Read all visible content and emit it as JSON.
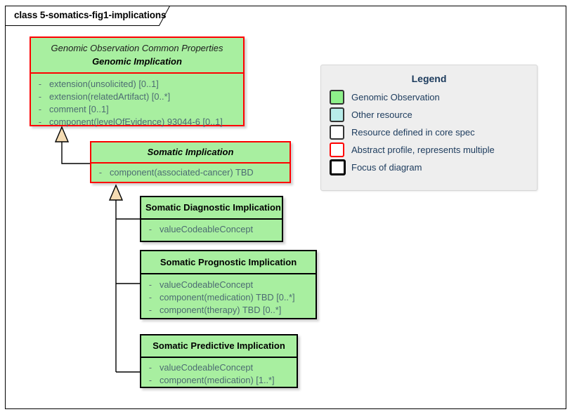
{
  "diagram": {
    "tab_label": "class 5-somatics-fig1-implications",
    "colors": {
      "genomic_observation_fill": "#a8efa0",
      "other_resource_fill": "#b8ece9",
      "core_spec_fill": "#ffffff",
      "abstract_border": "#ff0000",
      "focus_border": "#000000",
      "legend_background": "#eeeeee",
      "legend_text": "#1b3a5c",
      "attribute_text": "#4c6b72",
      "inheritance_arrow_fill": "#f5dcb3"
    }
  },
  "classes": [
    {
      "id": "genomic-implication",
      "stereotype": "Genomic Observation Common Properties",
      "name": "Genomic Implication",
      "abstract": true,
      "border": "red",
      "attributes": [
        {
          "visibility": "-",
          "name": "extension(unsolicited) [0..1]"
        },
        {
          "visibility": "-",
          "name": "extension(relatedArtifact) [0..*]"
        },
        {
          "visibility": "-",
          "name": "comment [0..1]"
        },
        {
          "visibility": "-",
          "name": "component(levelOfEvidence) 93044-6 [0..1]"
        }
      ]
    },
    {
      "id": "somatic-implication",
      "stereotype": "",
      "name": "Somatic Implication",
      "abstract": true,
      "border": "red",
      "attributes": [
        {
          "visibility": "-",
          "name": "component(associated-cancer) TBD"
        }
      ]
    },
    {
      "id": "somatic-diagnostic-implication",
      "stereotype": "",
      "name": "Somatic Diagnostic Implication",
      "abstract": false,
      "border": "black",
      "attributes": [
        {
          "visibility": "-",
          "name": "valueCodeableConcept"
        }
      ]
    },
    {
      "id": "somatic-prognostic-implication",
      "stereotype": "",
      "name": "Somatic Prognostic Implication",
      "abstract": false,
      "border": "black",
      "attributes": [
        {
          "visibility": "-",
          "name": "valueCodeableConcept"
        },
        {
          "visibility": "-",
          "name": "component(medication) TBD [0..*]"
        },
        {
          "visibility": "-",
          "name": "component(therapy) TBD [0..*]"
        }
      ]
    },
    {
      "id": "somatic-predictive-implication",
      "stereotype": "",
      "name": "Somatic Predictive Implication",
      "abstract": false,
      "border": "black",
      "attributes": [
        {
          "visibility": "-",
          "name": "valueCodeableConcept"
        },
        {
          "visibility": "-",
          "name": "component(medication) [1..*]"
        }
      ]
    }
  ],
  "legend": {
    "title": "Legend",
    "items": [
      {
        "label": "Genomic Observation",
        "fill": "#8ef08a",
        "border": "#333333",
        "border_width": "2px"
      },
      {
        "label": "Other resource",
        "fill": "#b8ece9",
        "border": "#333333",
        "border_width": "2px"
      },
      {
        "label": "Resource defined in core spec",
        "fill": "#ffffff",
        "border": "#333333",
        "border_width": "2px"
      },
      {
        "label": "Abstract profile, represents multiple",
        "fill": "#ffffff",
        "border": "#ff0000",
        "border_width": "2px"
      },
      {
        "label": "Focus of diagram",
        "fill": "#ffffff",
        "border": "#000000",
        "border_width": "3px"
      }
    ]
  },
  "relationships": [
    {
      "type": "generalization",
      "from": "somatic-implication",
      "to": "genomic-implication"
    },
    {
      "type": "generalization",
      "from": "somatic-diagnostic-implication",
      "to": "somatic-implication"
    },
    {
      "type": "generalization",
      "from": "somatic-prognostic-implication",
      "to": "somatic-implication"
    },
    {
      "type": "generalization",
      "from": "somatic-predictive-implication",
      "to": "somatic-implication"
    }
  ]
}
